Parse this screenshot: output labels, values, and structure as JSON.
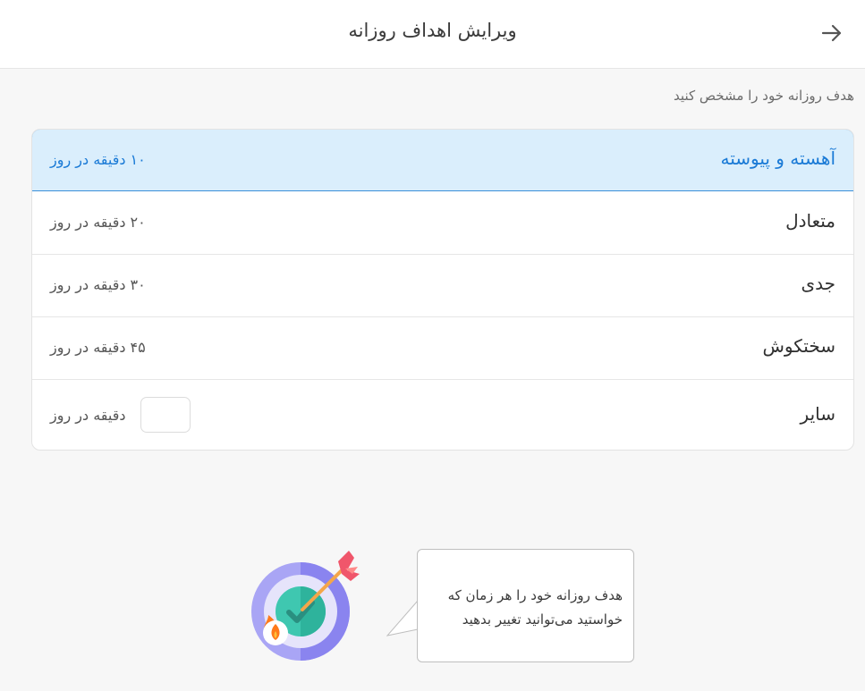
{
  "header": {
    "title": "ویرایش اهداف روزانه",
    "back_icon": "arrow-right-icon"
  },
  "subtitle": "هدف روزانه خود را مشخص کنید",
  "options": [
    {
      "name": "آهسته و پیوسته",
      "minutes": "۱۰",
      "unit": "دقیقه در روز",
      "selected": true
    },
    {
      "name": "متعادل",
      "minutes": "۲۰",
      "unit": "دقیقه در روز",
      "selected": false
    },
    {
      "name": "جدی",
      "minutes": "۳۰",
      "unit": "دقیقه در روز",
      "selected": false
    },
    {
      "name": "سختکوش",
      "minutes": "۴۵",
      "unit": "دقیقه در روز",
      "selected": false
    }
  ],
  "custom": {
    "name": "سایر",
    "value": "",
    "unit": "دقیقه در روز"
  },
  "tip": {
    "text": "هدف روزانه خود را هر زمان که خواستید می‌توانید تغییر بدهید",
    "icon": "target-dart-icon"
  },
  "colors": {
    "accent": "#1a7ad6",
    "selected_bg": "#daeefc"
  }
}
